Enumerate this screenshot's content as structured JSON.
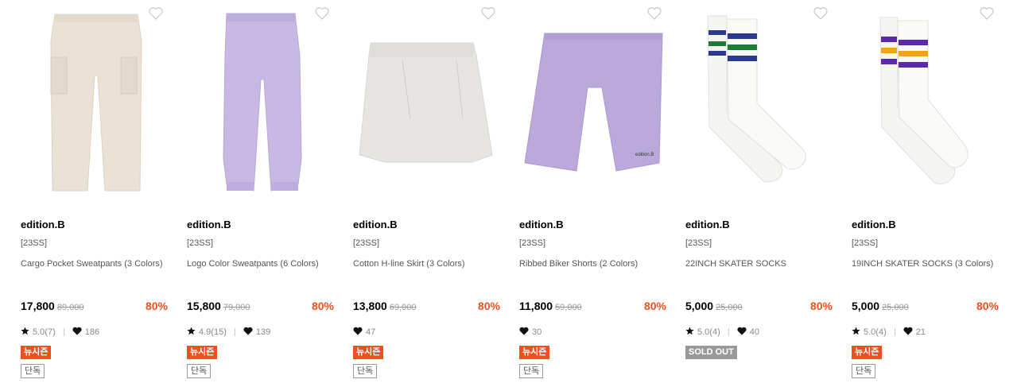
{
  "colors": {
    "accent": "#f0501e",
    "sold_out": "#999999"
  },
  "icons": {
    "wishlist": "heart-outline-icon",
    "rating": "star-icon",
    "likes": "heart-icon"
  },
  "products": [
    {
      "brand": "edition.B",
      "season": "[23SS]",
      "name": "Cargo Pocket Sweatpants (3 Colors)",
      "price": "17,800",
      "original_price": "89,000",
      "discount": "80%",
      "rating": "5.0(7)",
      "likes": "186",
      "badge": "뉴시즌",
      "exclusive": "단독",
      "image": "beige cargo sweatpants"
    },
    {
      "brand": "edition.B",
      "season": "[23SS]",
      "name": "Logo Color Sweatpants (6 Colors)",
      "price": "15,800",
      "original_price": "79,000",
      "discount": "80%",
      "rating": "4.9(15)",
      "likes": "139",
      "badge": "뉴시즌",
      "exclusive": "단독",
      "image": "lavender jogger sweatpants"
    },
    {
      "brand": "edition.B",
      "season": "[23SS]",
      "name": "Cotton H-line Skirt (3 Colors)",
      "price": "13,800",
      "original_price": "69,000",
      "discount": "80%",
      "rating": "",
      "likes": "47",
      "badge": "뉴시즌",
      "exclusive": "단독",
      "image": "light grey h-line skirt"
    },
    {
      "brand": "edition.B",
      "season": "[23SS]",
      "name": "Ribbed Biker Shorts (2 Colors)",
      "price": "11,800",
      "original_price": "59,000",
      "discount": "80%",
      "rating": "",
      "likes": "30",
      "badge": "뉴시즌",
      "exclusive": "단독",
      "image": "lavender biker shorts",
      "logo_text": "edition.B"
    },
    {
      "brand": "edition.B",
      "season": "[23SS]",
      "name": "22INCH SKATER SOCKS",
      "price": "5,000",
      "original_price": "25,000",
      "discount": "80%",
      "rating": "5.0(4)",
      "likes": "40",
      "badge": "SOLD OUT",
      "exclusive": "",
      "image": "white skater socks navy green stripes"
    },
    {
      "brand": "edition.B",
      "season": "[23SS]",
      "name": "19INCH SKATER SOCKS (3 Colors)",
      "price": "5,000",
      "original_price": "25,000",
      "discount": "80%",
      "rating": "5.0(4)",
      "likes": "21",
      "badge": "뉴시즌",
      "exclusive": "단독",
      "image": "white skater socks purple yellow stripes"
    }
  ]
}
